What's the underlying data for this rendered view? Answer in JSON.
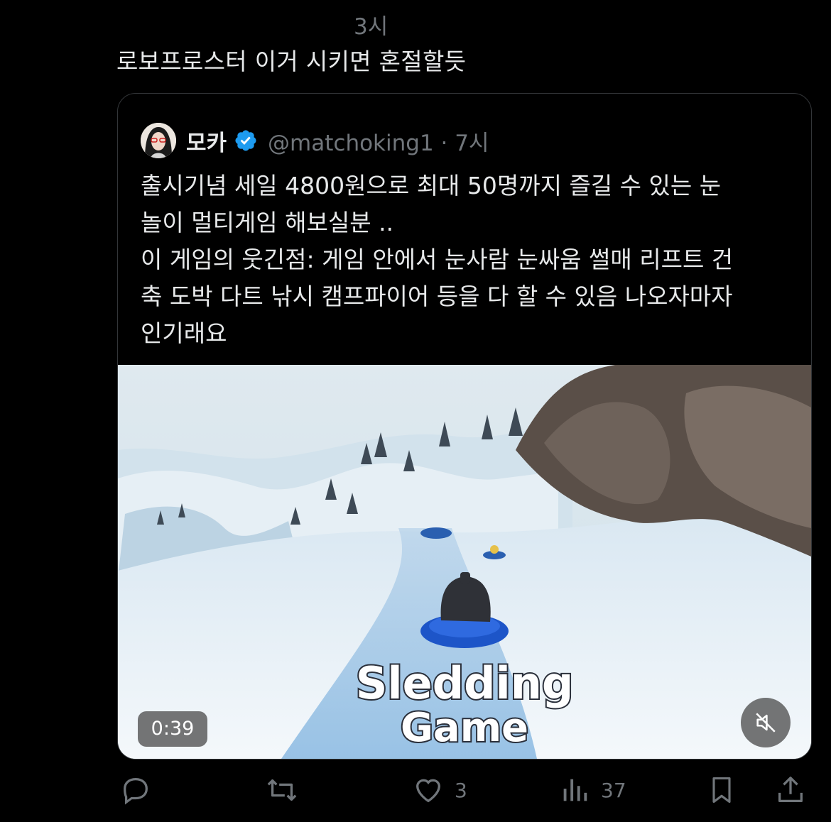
{
  "tweet": {
    "time": "3시",
    "text": "로보프로스터 이거 시키면 혼절할듯"
  },
  "quote": {
    "display_name": "모카",
    "handle_time": "@matchoking1 · 7시",
    "verified": true,
    "body": "출시기념 세일 4800원으로 최대 50명까지 즐길 수 있는 눈\n놀이 멀티게임 해보실분 ..\n이 게임의 웃긴점: 게임 안에서 눈사람 눈싸움 썰매 리프트 건\n축 도박 다트 낚시 캠프파이어 등을 다 할 수 있음 나오자마자\n인기래요",
    "video": {
      "duration": "0:39",
      "logo_line1": "Sledding",
      "logo_line2": "Game",
      "muted": true
    }
  },
  "actions": {
    "reply_icon": "reply-icon",
    "retweet_icon": "retweet-icon",
    "like_count": "3",
    "views_count": "37",
    "bookmark_icon": "bookmark-icon",
    "share_icon": "share-icon"
  },
  "colors": {
    "background": "#000000",
    "text": "#e7e9ea",
    "muted_text": "#71767b",
    "verified_blue": "#1d9bf0"
  }
}
